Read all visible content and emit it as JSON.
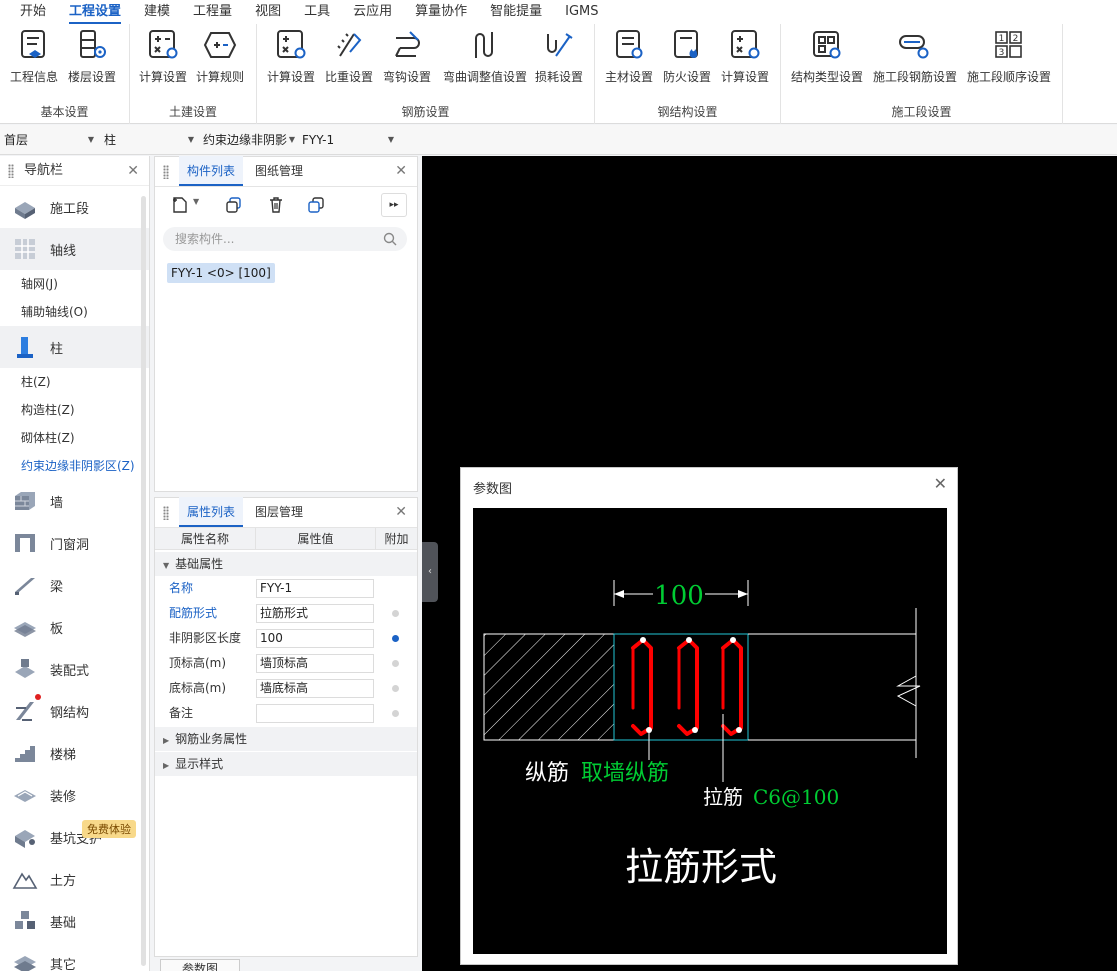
{
  "menu": [
    "开始",
    "工程设置",
    "建模",
    "工程量",
    "视图",
    "工具",
    "云应用",
    "算量协作",
    "智能提量",
    "IGMS"
  ],
  "menu_active_index": 1,
  "ribbon": {
    "groups": [
      {
        "label": "基本设置",
        "buttons": [
          "工程信息",
          "楼层设置"
        ]
      },
      {
        "label": "土建设置",
        "buttons": [
          "计算设置",
          "计算规则"
        ]
      },
      {
        "label": "钢筋设置",
        "buttons": [
          "计算设置",
          "比重设置",
          "弯钩设置",
          "弯曲调整值设置",
          "损耗设置"
        ]
      },
      {
        "label": "钢结构设置",
        "buttons": [
          "主材设置",
          "防火设置",
          "计算设置"
        ]
      },
      {
        "label": "施工段设置",
        "buttons": [
          "结构类型设置",
          "施工段钢筋设置",
          "施工段顺序设置"
        ]
      }
    ]
  },
  "selectors": {
    "floor": "首层",
    "type": "柱",
    "subtype": "约束边缘非阴影",
    "component": "FYY-1"
  },
  "nav": {
    "title": "导航栏",
    "items": [
      {
        "kind": "cat",
        "label": "施工段",
        "icon": "construction-segment-icon"
      },
      {
        "kind": "cat",
        "label": "轴线",
        "icon": "axis-grid-icon",
        "shaded": true
      },
      {
        "kind": "sub",
        "label": "轴网(J)"
      },
      {
        "kind": "sub",
        "label": "辅助轴线(O)"
      },
      {
        "kind": "cat",
        "label": "柱",
        "icon": "column-icon",
        "shaded": true
      },
      {
        "kind": "sub",
        "label": "柱(Z)"
      },
      {
        "kind": "sub",
        "label": "构造柱(Z)"
      },
      {
        "kind": "sub",
        "label": "砌体柱(Z)"
      },
      {
        "kind": "sub",
        "label": "约束边缘非阴影区(Z)",
        "active": true
      },
      {
        "kind": "cat",
        "label": "墙",
        "icon": "wall-icon"
      },
      {
        "kind": "cat",
        "label": "门窗洞",
        "icon": "door-window-icon"
      },
      {
        "kind": "cat",
        "label": "梁",
        "icon": "beam-icon"
      },
      {
        "kind": "cat",
        "label": "板",
        "icon": "slab-icon"
      },
      {
        "kind": "cat",
        "label": "装配式",
        "icon": "prefab-icon"
      },
      {
        "kind": "cat",
        "label": "钢结构",
        "icon": "steel-structure-icon",
        "dot": true
      },
      {
        "kind": "cat",
        "label": "楼梯",
        "icon": "stair-icon"
      },
      {
        "kind": "cat",
        "label": "装修",
        "icon": "decoration-icon"
      },
      {
        "kind": "cat",
        "label": "基坑支护",
        "icon": "pit-support-icon",
        "badge": "免费体验"
      },
      {
        "kind": "cat",
        "label": "土方",
        "icon": "earthwork-icon"
      },
      {
        "kind": "cat",
        "label": "基础",
        "icon": "foundation-icon"
      },
      {
        "kind": "cat",
        "label": "其它",
        "icon": "other-icon"
      }
    ]
  },
  "component_panel": {
    "tabs": [
      "构件列表",
      "图纸管理"
    ],
    "search_placeholder": "搜索构件...",
    "items": [
      "FYY-1 <0> [100]"
    ]
  },
  "property_panel": {
    "tabs": [
      "属性列表",
      "图层管理"
    ],
    "columns": [
      "属性名称",
      "属性值",
      "附加"
    ],
    "section_basic": "基础属性",
    "rows": [
      {
        "name": "名称",
        "value": "FYY-1",
        "blue": true,
        "dot": "none"
      },
      {
        "name": "配筋形式",
        "value": "拉筋形式",
        "blue": true,
        "dot": "off"
      },
      {
        "name": "非阴影区长度",
        "value": "100",
        "blue": false,
        "dot": "on"
      },
      {
        "name": "顶标高(m)",
        "value": "墙顶标高",
        "blue": false,
        "dot": "off"
      },
      {
        "name": "底标高(m)",
        "value": "墙底标高",
        "blue": false,
        "dot": "off"
      },
      {
        "name": "备注",
        "value": "",
        "blue": false,
        "dot": "off"
      }
    ],
    "section_rebar": "钢筋业务属性",
    "section_display": "显示样式"
  },
  "dialog": {
    "title": "参数图",
    "dimension": "100",
    "label_longitudinal": "纵筋",
    "label_longitudinal_value": "取墙纵筋",
    "label_tie": "拉筋",
    "label_tie_value": "C6@100",
    "caption": "拉筋形式"
  },
  "bottom_button": "参数图",
  "colors": {
    "accent": "#1b62c5",
    "rebar": "#ff0000",
    "dim": "#00cc33",
    "cyan": "#22c6d6"
  }
}
